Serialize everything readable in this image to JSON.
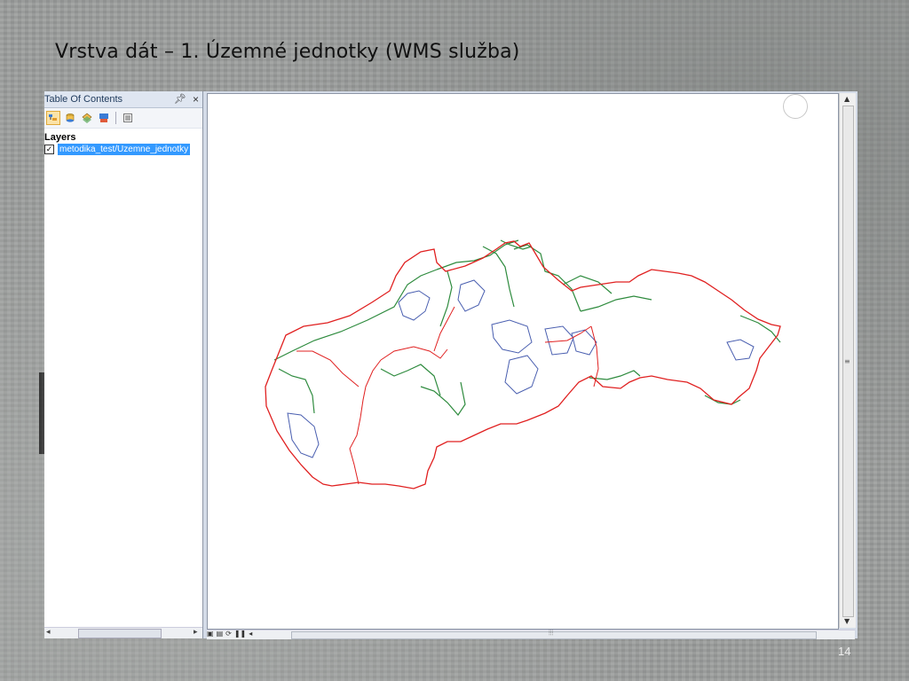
{
  "slide": {
    "title": "Vrstva dát – 1. Územné jednotky (WMS služba)",
    "page_number": "14"
  },
  "toc": {
    "title": "Table Of Contents",
    "pin_icon": "pin-icon",
    "close_icon": "close-icon",
    "toolbar": [
      "list-by-drawing-order-icon",
      "list-by-source-icon",
      "list-by-visibility-icon",
      "list-by-selection-icon",
      "options-icon"
    ],
    "layers_label": "Layers",
    "layers": [
      {
        "name": "metodika_test/Uzemne_jednotky",
        "checked": true,
        "selected": true
      }
    ]
  },
  "map": {
    "colors": {
      "country_border": "#e02020",
      "region_border": "#2e8b3e",
      "district_border": "#4a5fb0"
    }
  },
  "colors": {
    "selection": "#3399ff",
    "toc_header": "#dfe6f1"
  }
}
